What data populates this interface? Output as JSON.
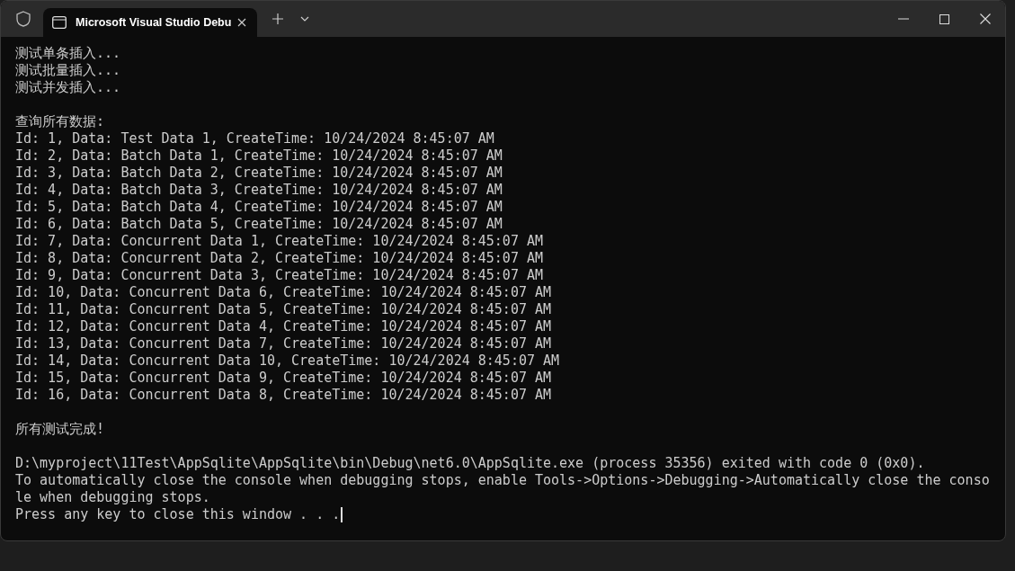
{
  "window": {
    "title": "Microsoft Visual Studio Debu"
  },
  "console": {
    "blocks": [
      [
        "测试单条插入...",
        "测试批量插入...",
        "测试并发插入..."
      ],
      [
        "查询所有数据:",
        "Id: 1, Data: Test Data 1, CreateTime: 10/24/2024 8:45:07 AM",
        "Id: 2, Data: Batch Data 1, CreateTime: 10/24/2024 8:45:07 AM",
        "Id: 3, Data: Batch Data 2, CreateTime: 10/24/2024 8:45:07 AM",
        "Id: 4, Data: Batch Data 3, CreateTime: 10/24/2024 8:45:07 AM",
        "Id: 5, Data: Batch Data 4, CreateTime: 10/24/2024 8:45:07 AM",
        "Id: 6, Data: Batch Data 5, CreateTime: 10/24/2024 8:45:07 AM",
        "Id: 7, Data: Concurrent Data 1, CreateTime: 10/24/2024 8:45:07 AM",
        "Id: 8, Data: Concurrent Data 2, CreateTime: 10/24/2024 8:45:07 AM",
        "Id: 9, Data: Concurrent Data 3, CreateTime: 10/24/2024 8:45:07 AM",
        "Id: 10, Data: Concurrent Data 6, CreateTime: 10/24/2024 8:45:07 AM",
        "Id: 11, Data: Concurrent Data 5, CreateTime: 10/24/2024 8:45:07 AM",
        "Id: 12, Data: Concurrent Data 4, CreateTime: 10/24/2024 8:45:07 AM",
        "Id: 13, Data: Concurrent Data 7, CreateTime: 10/24/2024 8:45:07 AM",
        "Id: 14, Data: Concurrent Data 10, CreateTime: 10/24/2024 8:45:07 AM",
        "Id: 15, Data: Concurrent Data 9, CreateTime: 10/24/2024 8:45:07 AM",
        "Id: 16, Data: Concurrent Data 8, CreateTime: 10/24/2024 8:45:07 AM"
      ],
      [
        "所有测试完成!"
      ],
      [
        "D:\\myproject\\11Test\\AppSqlite\\AppSqlite\\bin\\Debug\\net6.0\\AppSqlite.exe (process 35356) exited with code 0 (0x0).",
        "To automatically close the console when debugging stops, enable Tools->Options->Debugging->Automatically close the conso",
        "le when debugging stops.",
        "Press any key to close this window . . ."
      ]
    ]
  }
}
